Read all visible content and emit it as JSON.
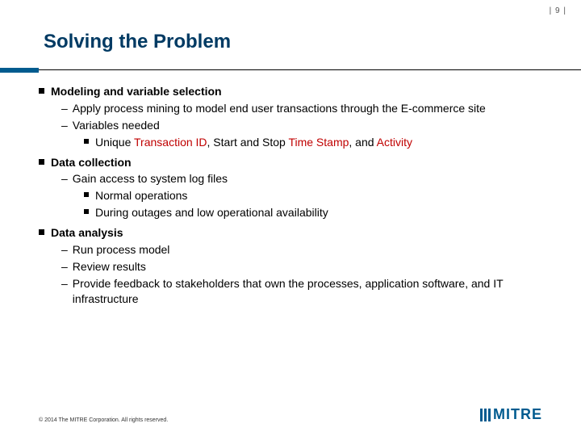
{
  "page_number": "| 9 |",
  "title": "Solving the Problem",
  "sections": [
    {
      "heading": "Modeling and variable selection",
      "items": [
        {
          "text": "Apply process mining to model end user transactions through the E-commerce site"
        },
        {
          "text": "Variables needed",
          "sub": [
            {
              "parts": [
                {
                  "t": "Unique ",
                  "red": false
                },
                {
                  "t": "Transaction ID",
                  "red": true
                },
                {
                  "t": ", Start and Stop ",
                  "red": false
                },
                {
                  "t": "Time Stamp",
                  "red": true
                },
                {
                  "t": ", and ",
                  "red": false
                },
                {
                  "t": "Activity",
                  "red": true
                }
              ]
            }
          ]
        }
      ]
    },
    {
      "heading": "Data collection",
      "items": [
        {
          "text": "Gain access to system log files",
          "sub": [
            {
              "parts": [
                {
                  "t": "Normal operations",
                  "red": false
                }
              ]
            },
            {
              "parts": [
                {
                  "t": "During outages and low operational availability",
                  "red": false
                }
              ]
            }
          ]
        }
      ]
    },
    {
      "heading": "Data analysis",
      "items": [
        {
          "text": "Run process model"
        },
        {
          "text": "Review results"
        },
        {
          "text": "Provide feedback to stakeholders that own the processes, application software, and IT infrastructure"
        }
      ]
    }
  ],
  "copyright": "© 2014 The MITRE Corporation. All rights reserved.",
  "logo_text": "MITRE"
}
